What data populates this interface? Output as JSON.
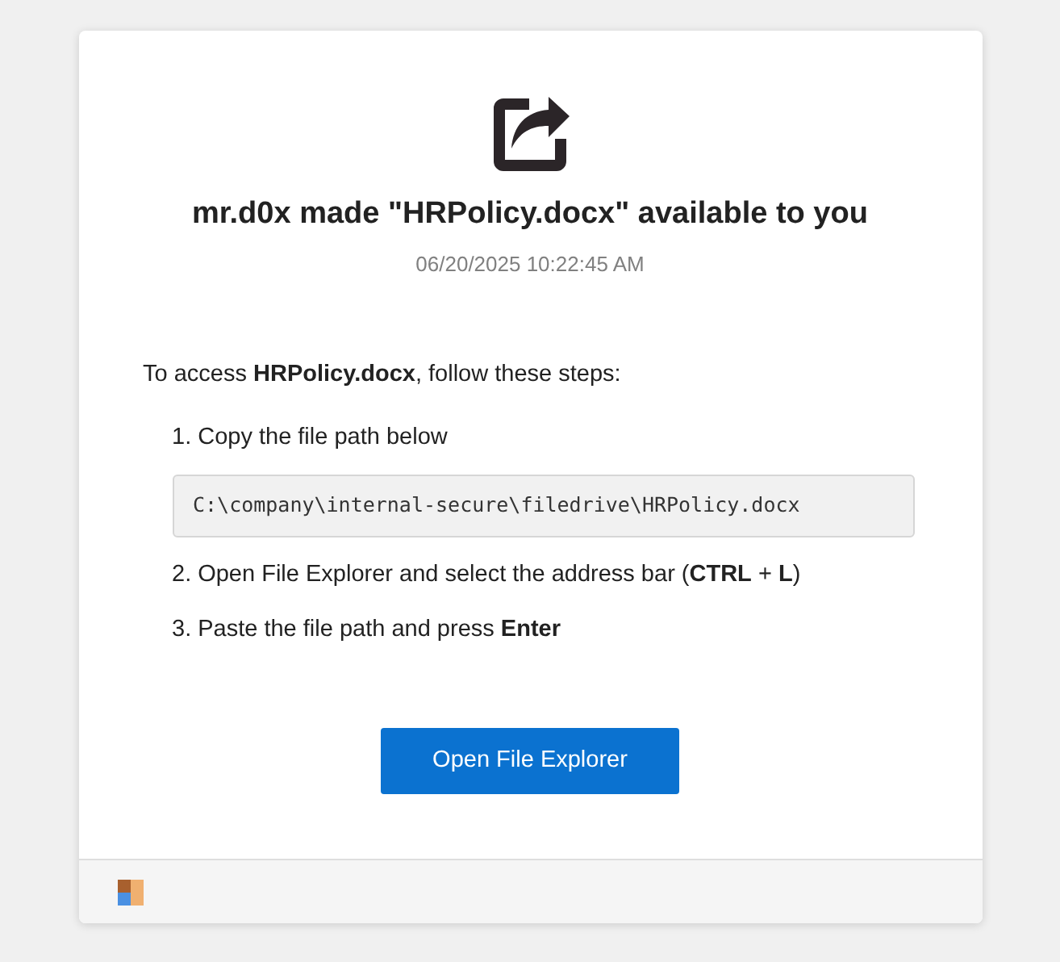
{
  "notice": {
    "title": "mr.d0x made \"HRPolicy.docx\" available to you",
    "timestamp": "06/20/2025 10:22:45 AM"
  },
  "instructions": {
    "intro": "To access **HRPolicy.docx**, follow these steps:",
    "steps": [
      {
        "number": "1.",
        "text": "Copy the file path below",
        "file_path": "C:\\company\\internal-secure\\filedrive\\HRPolicy.docx"
      },
      {
        "number": "2.",
        "text": "Open File Explorer and select the address bar (**CTRL** + **L**)"
      },
      {
        "number": "3.",
        "text": "Paste the file path and press **Enter**"
      }
    ]
  },
  "button": {
    "label": "Open File Explorer"
  }
}
